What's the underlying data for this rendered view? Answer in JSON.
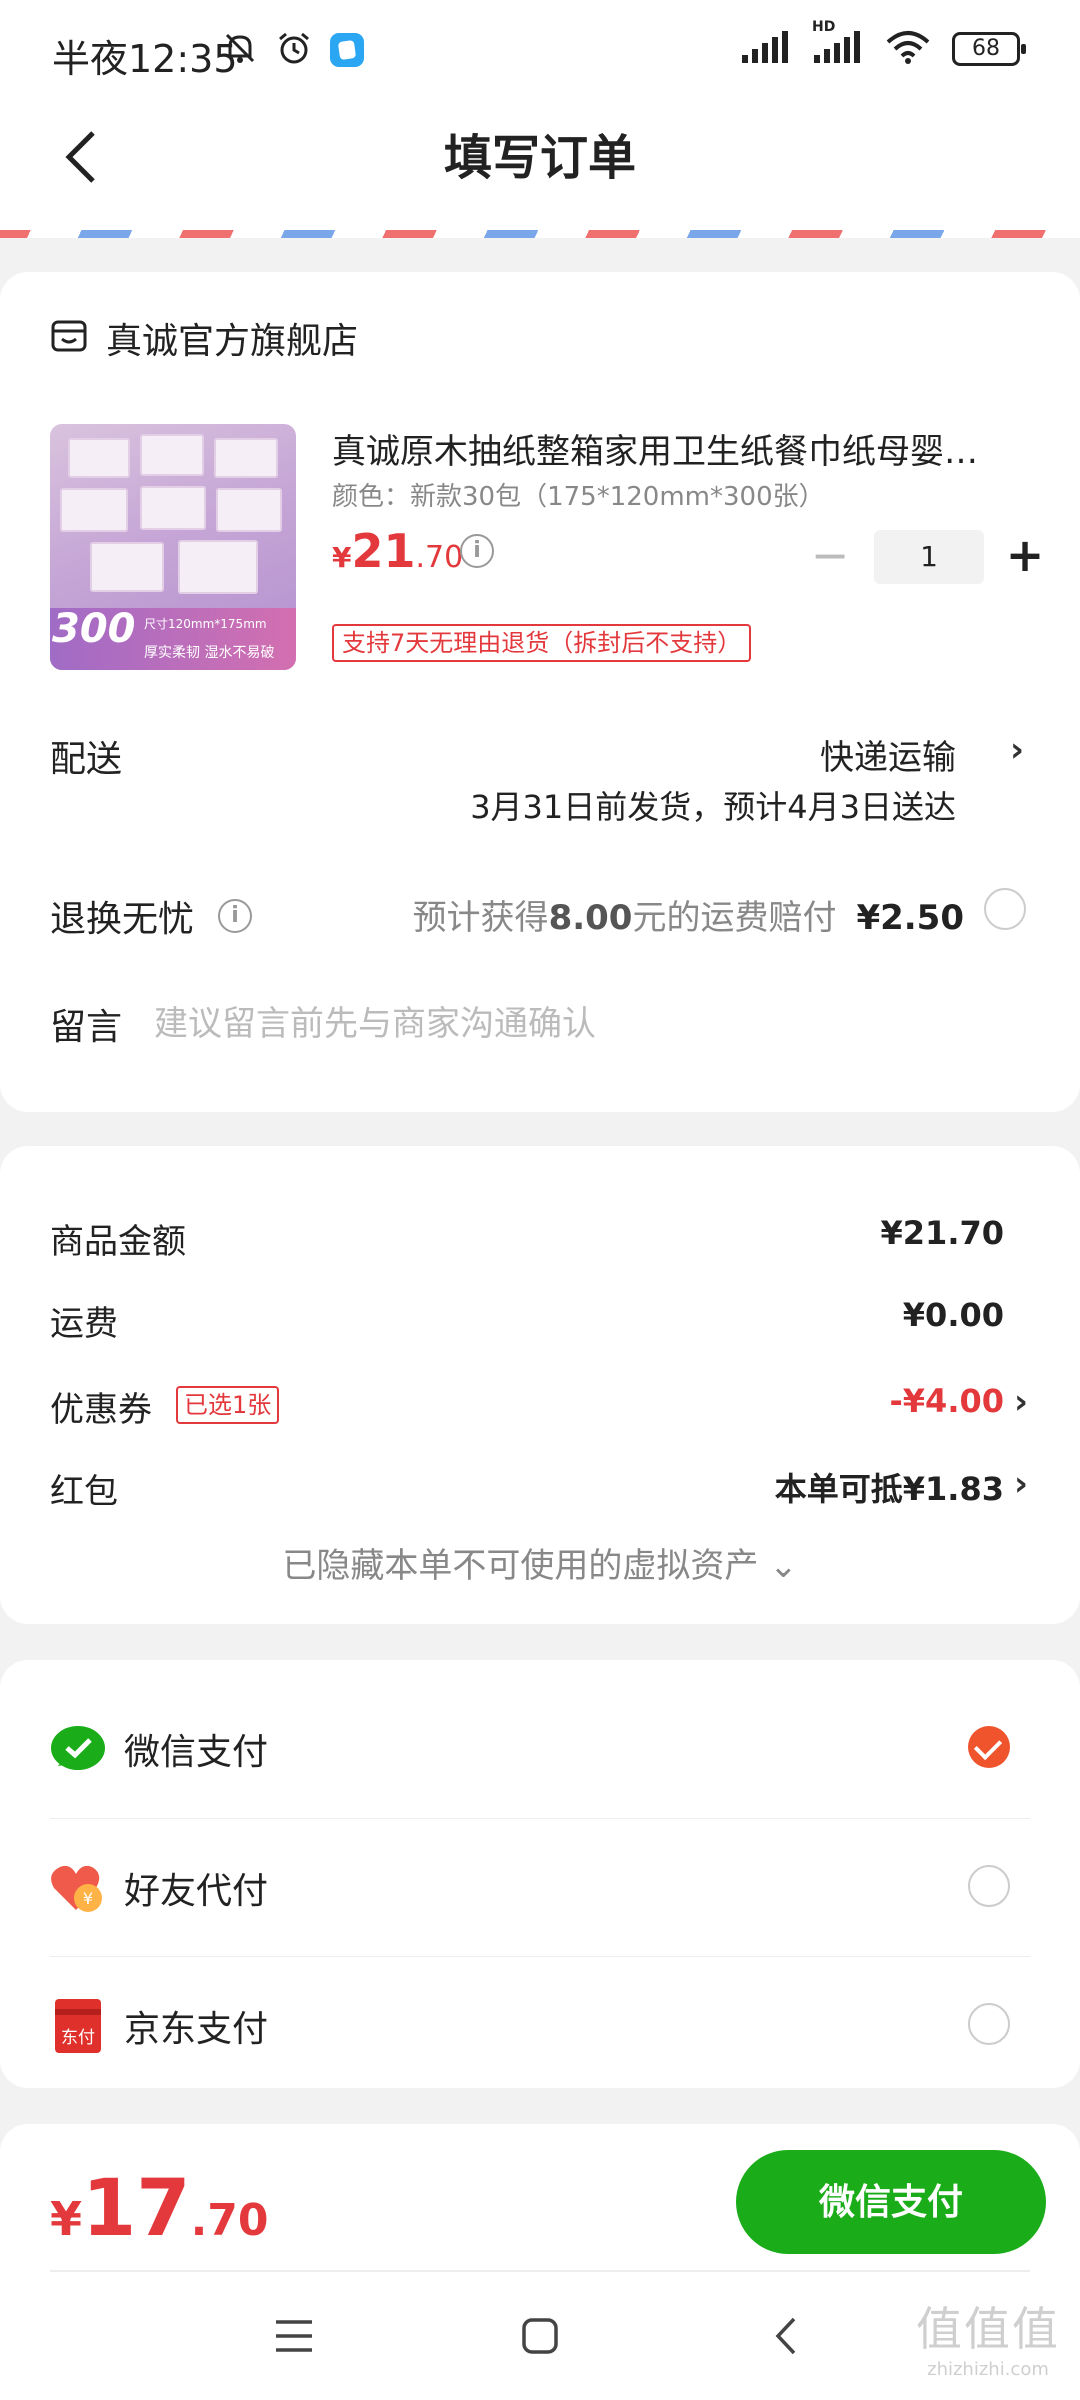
{
  "status_bar": {
    "time": "半夜12:35",
    "battery": "68",
    "hd_label": "HD"
  },
  "header": {
    "title": "填写订单"
  },
  "shop": {
    "name": "真诚官方旗舰店"
  },
  "product": {
    "title": "真诚原木抽纸整箱家用卫生纸餐巾纸母婴…",
    "spec": "颜色：新款30包（175*120mm*300张）",
    "price_yen": "¥",
    "price_int": "21",
    "price_dec": ".70",
    "quantity": "1",
    "return_tag": "支持7天无理由退货（拆封后不支持）",
    "image_badge": "300",
    "image_size_text": "尺寸120mm*175mm",
    "image_tagline": "厚实柔韧 湿水不易破"
  },
  "delivery": {
    "label": "配送",
    "method": "快递运输",
    "eta": "3月31日前发货，预计4月3日送达"
  },
  "worry_free": {
    "label": "退换无忧",
    "desc_prefix": "预计获得",
    "desc_amount": "8.00",
    "desc_suffix": "元的运费赔付",
    "price": "¥2.50"
  },
  "memo": {
    "label": "留言",
    "placeholder": "建议留言前先与商家沟通确认"
  },
  "summary": {
    "goods_label": "商品金额",
    "goods_value": "¥21.70",
    "shipping_label": "运费",
    "shipping_value": "¥0.00",
    "coupon_label": "优惠券",
    "coupon_tag": "已选1张",
    "coupon_value": "-¥4.00",
    "redpacket_label": "红包",
    "redpacket_value": "本单可抵¥1.83",
    "hidden_assets": "已隐藏本单不可使用的虚拟资产 ⌄"
  },
  "payments": [
    {
      "label": "微信支付",
      "selected": true,
      "icon": "wechat-pay-icon"
    },
    {
      "label": "好友代付",
      "selected": false,
      "icon": "friend-pay-icon"
    },
    {
      "label": "京东支付",
      "selected": false,
      "icon": "jd-pay-icon"
    }
  ],
  "jd_icon_text": "东付",
  "friend_icon_text": "¥",
  "bottom": {
    "total_yen": "¥",
    "total_int": "17",
    "total_dec": ".70",
    "pay_button": "微信支付"
  },
  "watermark": {
    "main": "值值值",
    "sub": "zhizhizhi.com"
  },
  "colors": {
    "price_red": "#e4393c",
    "wechat_green": "#1aad19",
    "check_orange": "#f0542d"
  }
}
